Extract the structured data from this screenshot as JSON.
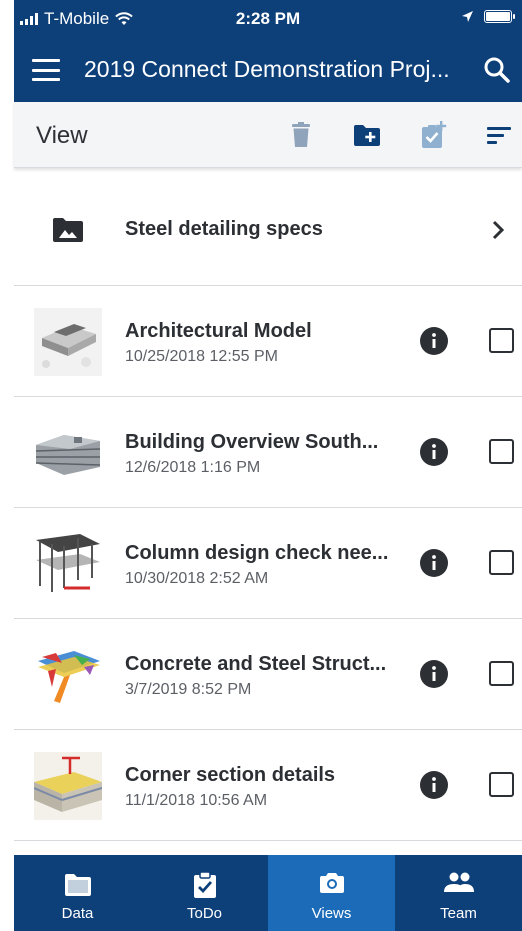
{
  "status_bar": {
    "carrier": "T-Mobile",
    "time": "2:28 PM"
  },
  "app_bar": {
    "title": "2019 Connect Demonstration Proj..."
  },
  "toolbar": {
    "label": "View"
  },
  "folder": {
    "name": "Steel detailing specs"
  },
  "items": [
    {
      "title": "Architectural Model",
      "date": "10/25/2018 12:55 PM"
    },
    {
      "title": "Building Overview South...",
      "date": "12/6/2018 1:16 PM"
    },
    {
      "title": "Column design check nee...",
      "date": "10/30/2018 2:52 AM"
    },
    {
      "title": "Concrete and Steel Struct...",
      "date": "3/7/2019 8:52 PM"
    },
    {
      "title": "Corner section details",
      "date": "11/1/2018 10:56 AM"
    }
  ],
  "nav": {
    "tabs": [
      {
        "label": "Data",
        "icon": "folder-icon"
      },
      {
        "label": "ToDo",
        "icon": "clipboard-check-icon"
      },
      {
        "label": "Views",
        "icon": "camera-icon",
        "active": true
      },
      {
        "label": "Team",
        "icon": "people-icon"
      }
    ]
  },
  "colors": {
    "primary": "#0d3f79",
    "active_tab": "#1b6bb8",
    "toolbar_bg": "#f4f5f7"
  }
}
